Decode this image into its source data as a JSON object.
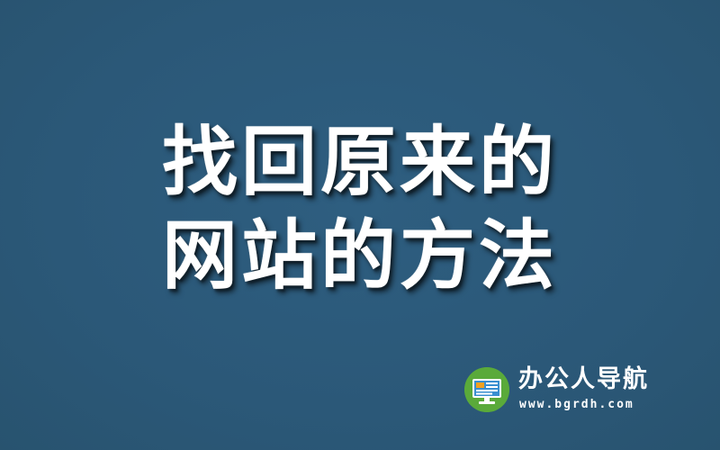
{
  "headline": {
    "line1": "找回原来的",
    "line2": "网站的方法"
  },
  "brand": {
    "name": "办公人导航",
    "url": "www.bgrdh.com",
    "logo_icon": "monitor-icon"
  },
  "colors": {
    "background": "#2c5a7a",
    "text": "#ffffff",
    "logo_green": "#5aaa3a",
    "logo_screen": "#3a8fd0",
    "logo_orange": "#f0a020"
  }
}
